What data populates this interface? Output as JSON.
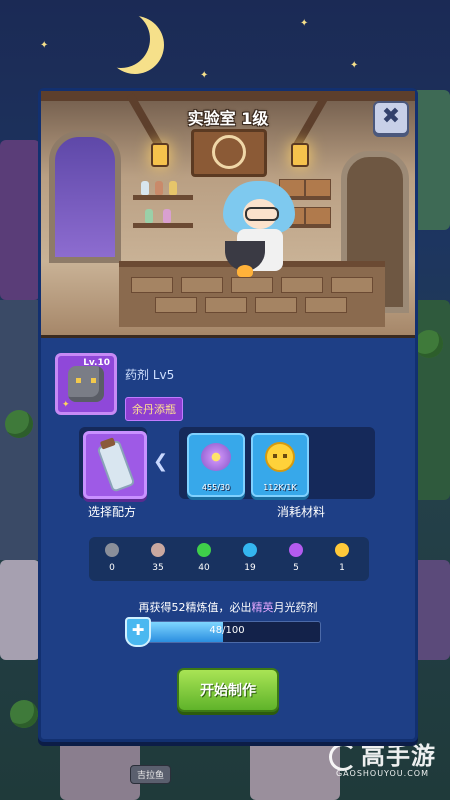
{
  "dialog": {
    "title": "实验室 1级",
    "close_icon": "close-icon"
  },
  "item": {
    "level": "Lv.10",
    "name": "药剂 Lv5",
    "tag": "余丹添瓶"
  },
  "recipe": {
    "label": "选择配方",
    "icon": "vial-icon"
  },
  "materials": {
    "label": "消耗材料",
    "items": [
      {
        "icon": "moon-flower-icon",
        "qty": "455/30"
      },
      {
        "icon": "gold-coin-icon",
        "qty": "112K/1K"
      }
    ]
  },
  "counts": [
    {
      "icon": "empty-slot-icon",
      "color": "#8a8f9a",
      "value": "0"
    },
    {
      "icon": "grey-orb-icon",
      "color": "#c9a8a0",
      "value": "35"
    },
    {
      "icon": "green-orb-icon",
      "color": "#3fcf4a",
      "value": "40"
    },
    {
      "icon": "blue-orb-icon",
      "color": "#34b6f0",
      "value": "19"
    },
    {
      "icon": "purple-orb-icon",
      "color": "#b35bef",
      "value": "5"
    },
    {
      "icon": "gold-orb-icon",
      "color": "#ffc93a",
      "value": "1"
    }
  ],
  "hint": {
    "prefix": "再获得52精炼值，必出",
    "highlight": "精英",
    "suffix": "月光药剂"
  },
  "progress": {
    "text": "48/100",
    "fraction": 0.48
  },
  "start_button": "开始制作",
  "map_sign": "吉拉鱼",
  "watermark": {
    "brand": "高手游",
    "domain": "GAOSHOUYOU.COM"
  },
  "colors": {
    "panel": "#1e3f86",
    "accent_purple": "#9e5ae6",
    "accent_blue": "#37a8ea",
    "button_green": "#6fbf2e"
  }
}
